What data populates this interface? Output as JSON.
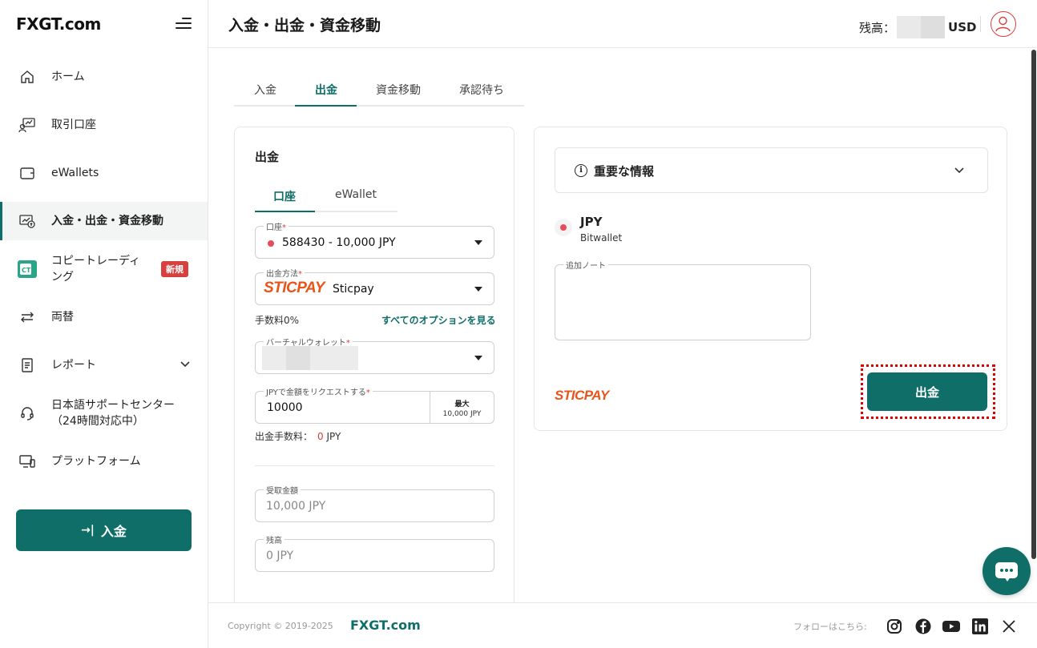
{
  "brand": {
    "logo": "FXGT.com",
    "accent": "#0f6e68",
    "red": "#d83f3f",
    "sticpay_color": "#e9541b"
  },
  "sidebar": {
    "items": [
      {
        "label": "ホーム",
        "icon": "home-icon"
      },
      {
        "label": "取引口座",
        "icon": "trading-account-icon"
      },
      {
        "label": "eWallets",
        "icon": "wallet-icon"
      },
      {
        "label": "入金・出金・資金移動",
        "icon": "transfer-icon",
        "active": true
      },
      {
        "label": "コピートレーディ\nング",
        "icon": "copy-trading-icon",
        "badge": "新規",
        "line1": "コピートレーディ",
        "line2": "ング"
      },
      {
        "label": "両替",
        "icon": "exchange-icon"
      },
      {
        "label": "レポート",
        "icon": "report-icon"
      },
      {
        "label": "日本語サポートセンター（24時間対応中）",
        "icon": "support-icon",
        "line1": "日本語サポートセンター",
        "line2": "（24時間対応中）"
      },
      {
        "label": "プラットフォーム",
        "icon": "platform-icon"
      }
    ],
    "deposit_button": "入金"
  },
  "header": {
    "title": "入金・出金・資金移動",
    "balance_label": "残高：",
    "balance_currency": "USD"
  },
  "main_tabs": [
    "入金",
    "出金",
    "資金移動",
    "承認待ち"
  ],
  "withdraw_form": {
    "title": "出金",
    "subtabs": [
      "口座",
      "eWallet"
    ],
    "account": {
      "label": "口座",
      "value": "588430 - 10,000 JPY"
    },
    "method": {
      "label": "出金方法",
      "logo": "STICPAY",
      "value": "Sticpay"
    },
    "fee_rate": "手数料0%",
    "see_all_options": "すべてのオプションを見る",
    "virtual_wallet": {
      "label": "バーチャルウォレット"
    },
    "amount": {
      "label": "JPYで金額をリクエストする",
      "value": "10000",
      "max_label": "最大",
      "max_value": "10,000 JPY"
    },
    "withdraw_fee_label": "出金手数料：",
    "withdraw_fee_value": "0",
    "withdraw_fee_unit": "JPY",
    "received": {
      "label": "受取金額",
      "value": "10,000 JPY"
    },
    "remaining": {
      "label": "残高",
      "value": "0 JPY"
    }
  },
  "details": {
    "info_title": "重要な情報",
    "currency": "JPY",
    "provider": "Bitwallet",
    "note_label": "追加ノート",
    "footer_logo": "STICPAY",
    "withdraw_button": "出金"
  },
  "footer": {
    "copyright": "Copyright © 2019-2025",
    "logo": "FXGT.com",
    "follow": "フォローはこちら:",
    "social": [
      "instagram-icon",
      "facebook-icon",
      "youtube-icon",
      "linkedin-icon",
      "x-icon"
    ]
  }
}
